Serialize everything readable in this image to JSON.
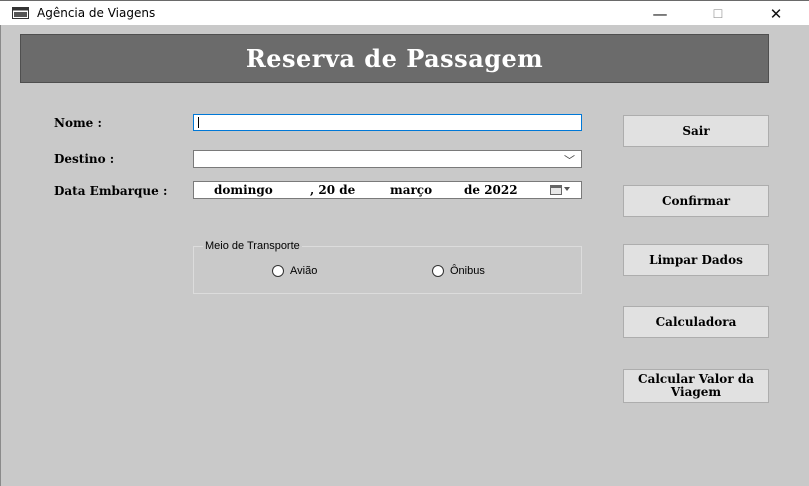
{
  "window": {
    "title": "Agência de Viagens",
    "minimize_glyph": "—",
    "maximize_glyph": "☐",
    "close_glyph": "✕"
  },
  "header": {
    "title": "Reserva de Passagem"
  },
  "form": {
    "name_label": "Nome :",
    "name_value": "",
    "destination_label": "Destino :",
    "destination_value": "",
    "date_label": "Data Embarque :",
    "date": {
      "weekday": "domingo",
      "day_part": ", 20 de",
      "month": "março",
      "year_part": "de 2022"
    }
  },
  "transport": {
    "legend": "Meio de Transporte",
    "options": [
      "Avião",
      "Ônibus"
    ]
  },
  "buttons": {
    "exit": "Sair",
    "confirm": "Confirmar",
    "clear": "Limpar Dados",
    "calculator": "Calculadora",
    "calculate_trip": "Calcular Valor da Viagem"
  },
  "colors": {
    "background": "#c9c9c9",
    "banner": "#6b6b6b",
    "focus_border": "#0078d7"
  }
}
